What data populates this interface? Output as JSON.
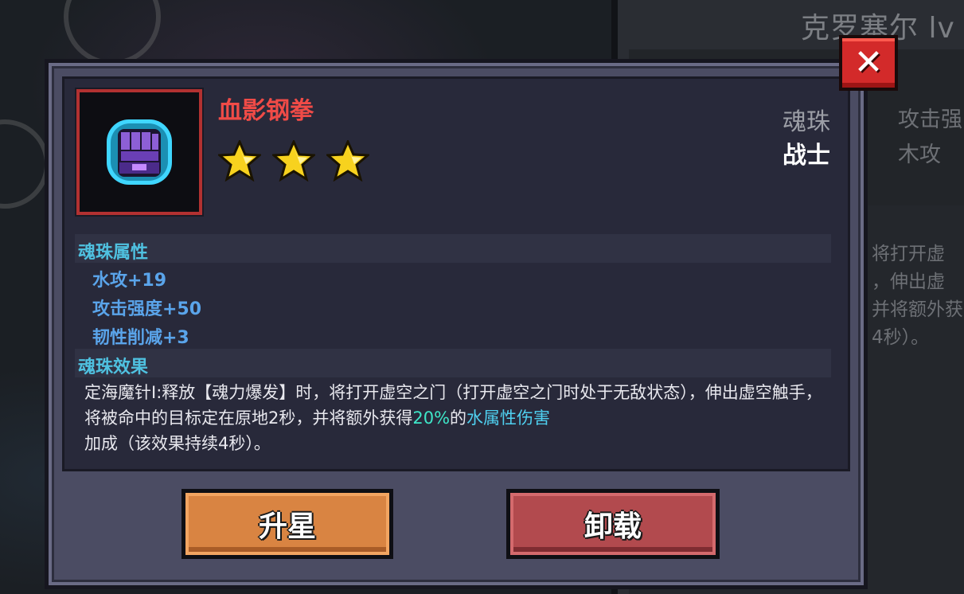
{
  "background": {
    "character_title": "克罗塞尔 lv",
    "stats": [
      "攻击强",
      "木攻"
    ],
    "desc_lines": [
      "将打开虚",
      "，伸出虚",
      "并将额外获",
      "4秒）。"
    ]
  },
  "item": {
    "name": "血影钢拳",
    "stars": 3,
    "type": "魂珠",
    "class": "战士"
  },
  "attributes": {
    "title": "魂珠属性",
    "lines": [
      "水攻+19",
      "攻击强度+50",
      "韧性削减+3"
    ]
  },
  "effect": {
    "title": "魂珠效果",
    "text_before": "定海魔针Ⅰ:释放【魂力爆发】时，将打开虚空之门（打开虚空之门时处于无敌状态），伸出虚空触手，将被命中的目标定在原地2秒，并将额外获得",
    "highlight_value": "20%",
    "text_mid": "的",
    "highlight_attr": "水属性伤害",
    "text_after": "加成（该效果持续4秒）。"
  },
  "buttons": {
    "close": "✕",
    "upgrade": "升星",
    "unequip": "卸载"
  },
  "colors": {
    "item_name": "#f04b47",
    "section_title": "#4fc1e0",
    "attribute": "#5aa4ea",
    "upgrade_button": "#d98442",
    "unequip_button": "#b24a4e",
    "close_button": "#d32a2a"
  }
}
